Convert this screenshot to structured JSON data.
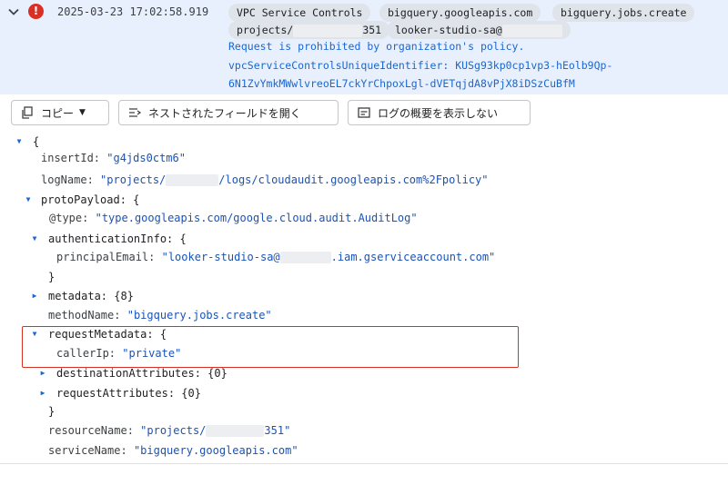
{
  "summary": {
    "timestamp": "2025-03-23 17:02:58.919",
    "chips": {
      "c1": "VPC Service Controls",
      "c2": "bigquery.googleapis.com",
      "c3": "bigquery.jobs.create",
      "c4_prefix": "projects/",
      "c4_suffix": "351",
      "c5": "looker-studio-sa@"
    },
    "message_1": "Request is prohibited by organization's policy.",
    "message_2": "vpcServiceControlsUniqueIdentifier: KUSg93kp0cp1vp3-hEolb9Qp-",
    "message_3": "6N1ZvYmkMWwlvreoEL7ckYrChpoxLgl-dVETqjdA8vPjX8iDSzCuBfM"
  },
  "toolbar": {
    "copy_label": "コピー",
    "expand_label": "ネストされたフィールドを開く",
    "summary_label": "ログの概要を表示しない"
  },
  "tree": {
    "open_brace": "{",
    "insertId_key": "insertId:",
    "insertId_val": "\"g4jds0ctm6\"",
    "logName_key": "logName:",
    "logName_val_a": "\"projects/",
    "logName_val_b": "/logs/cloudaudit.googleapis.com%2Fpolicy\"",
    "protoPayload_key": "protoPayload: {",
    "type_key": "@type:",
    "type_val": "\"type.googleapis.com/google.cloud.audit.AuditLog\"",
    "auth_key": "authenticationInfo: {",
    "principal_key": "principalEmail:",
    "principal_val_a": "\"looker-studio-sa@",
    "principal_val_b": ".iam.gserviceaccount.com\"",
    "close_brace": "}",
    "metadata_key": "metadata: {8}",
    "methodName_key": "methodName:",
    "methodName_val": "\"bigquery.jobs.create\"",
    "reqMeta_key": "requestMetadata: {",
    "callerIp_key": "callerIp:",
    "callerIp_val": "\"private\"",
    "destAttr_key": "destinationAttributes: {0}",
    "reqAttr_key": "requestAttributes: {0}",
    "resourceName_key": "resourceName:",
    "resourceName_val_a": "\"projects/",
    "resourceName_val_b": "351\"",
    "serviceName_key": "serviceName:",
    "serviceName_val": "\"bigquery.googleapis.com\""
  }
}
